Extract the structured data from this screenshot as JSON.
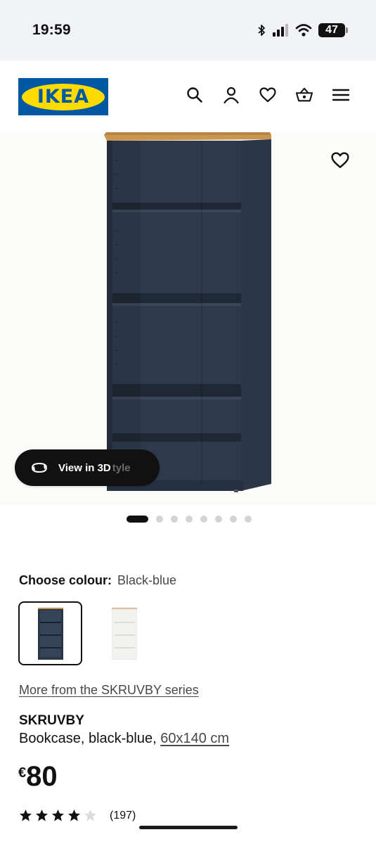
{
  "status_bar": {
    "time": "19:59",
    "battery": "47"
  },
  "header": {
    "brand": "IKEA",
    "icons": [
      "search-icon",
      "account-icon",
      "heart-icon",
      "basket-icon",
      "menu-icon"
    ]
  },
  "gallery": {
    "view_3d_label": "View in 3D",
    "ghost_text": "tyle",
    "dot_count": 8,
    "active_dot": 0
  },
  "colour": {
    "label": "Choose colour:",
    "selected": "Black-blue",
    "swatches": [
      {
        "name": "Black-blue",
        "selected": true
      },
      {
        "name": "White",
        "selected": false
      }
    ]
  },
  "product": {
    "series_link": "More from the SKRUVBY series",
    "name": "SKRUVBY",
    "description": "Bookcase, black-blue,",
    "size": "60x140 cm",
    "currency": "€",
    "price": "80",
    "rating": 4,
    "rating_max": 5,
    "review_count": "(197)"
  },
  "colors": {
    "ikea_blue": "#0058a3",
    "ikea_yellow": "#ffdb00",
    "bookcase_body": "#2b3647",
    "bookcase_top": "#c9964f"
  }
}
